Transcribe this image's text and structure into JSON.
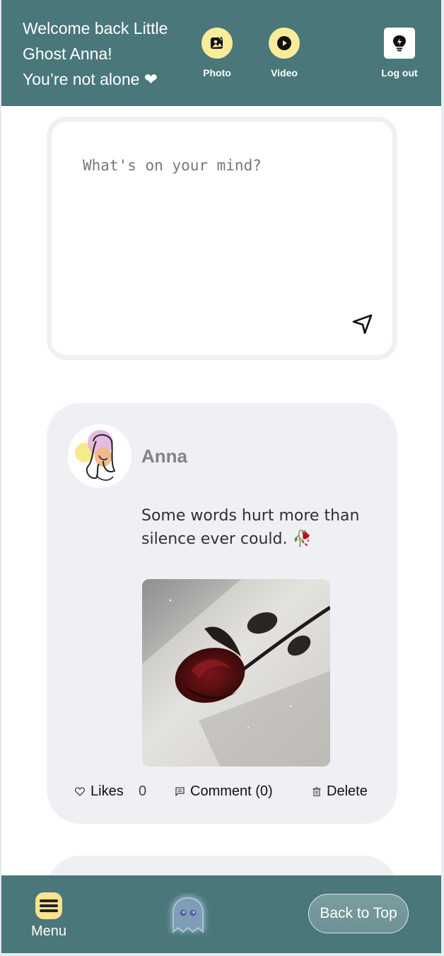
{
  "header": {
    "welcome_line1": "Welcome back Little",
    "welcome_line2": "Ghost Anna!",
    "welcome_line3": "You’re not alone ❤",
    "photo_label": "Photo",
    "video_label": "Video",
    "logout_label": "Log out"
  },
  "composer": {
    "placeholder": "What's on your mind?",
    "value": ""
  },
  "post": {
    "author": "Anna",
    "text_line1": "Some words hurt more than",
    "text_line2": "silence ever could. 🥀",
    "likes_label": "Likes",
    "likes_count": "0",
    "comment_label": "Comment (0)",
    "delete_label": "Delete"
  },
  "bottombar": {
    "menu_label": "Menu",
    "back_to_top_label": "Back to Top"
  },
  "colors": {
    "header_bg": "#49777a",
    "accent_yellow": "#fbeb9a",
    "card_bg": "#eff0f4"
  }
}
